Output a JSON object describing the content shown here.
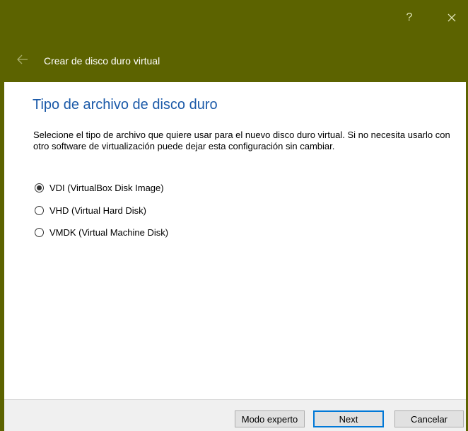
{
  "titlebar": {
    "help_label": "?",
    "close_icon": "close-icon",
    "back_icon": "back-arrow-icon",
    "wizard_title": "Crear de disco duro virtual"
  },
  "page": {
    "title": "Tipo de archivo de disco duro",
    "description": "Selecione el tipo de archivo que quiere usar para el nuevo disco duro virtual. Si no necesita usarlo con otro software de virtualización puede dejar esta configuración sin cambiar."
  },
  "options": [
    {
      "label": "VDI (VirtualBox Disk Image)",
      "checked": true
    },
    {
      "label": "VHD (Virtual Hard Disk)",
      "checked": false
    },
    {
      "label": "VMDK (Virtual Machine Disk)",
      "checked": false
    }
  ],
  "buttons": {
    "expert": "Modo experto",
    "next": "Next",
    "cancel": "Cancelar"
  },
  "colors": {
    "titlebar": "#5c6300",
    "title_text": "#1a59a8",
    "default_button_border": "#0078d7"
  }
}
